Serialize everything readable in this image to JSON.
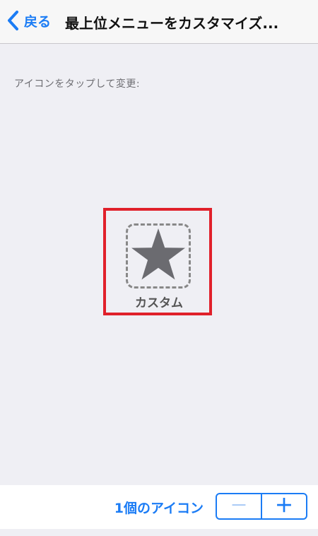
{
  "nav": {
    "back_label": "戻る",
    "title": "最上位メニューをカスタマイズ..."
  },
  "content": {
    "hint": "アイコンをタップして変更:",
    "icon": {
      "name": "star-icon",
      "label": "カスタム"
    }
  },
  "toolbar": {
    "count_label": "1個のアイコン",
    "minus_label": "－",
    "plus_label": "＋"
  },
  "colors": {
    "accent": "#1b7cf5",
    "highlight": "#e0202a",
    "background": "#efeff4"
  }
}
